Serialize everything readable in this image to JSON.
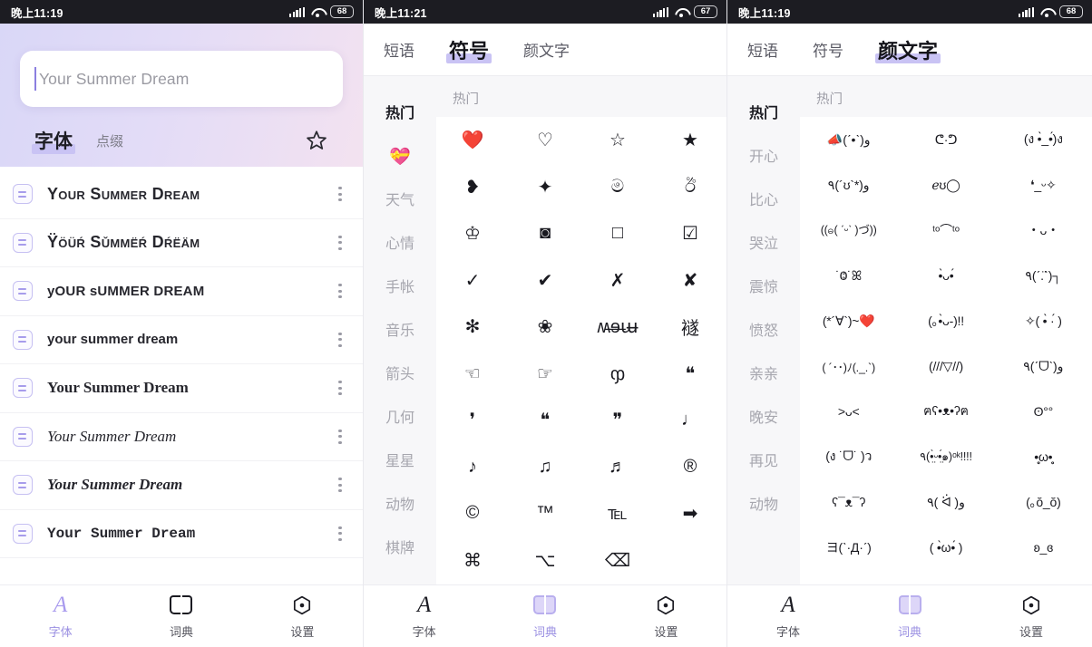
{
  "panels": [
    {
      "id": "fonts-screen",
      "status": {
        "time": "晚上11:19",
        "battery": "68"
      },
      "search": {
        "value": "",
        "placeholder": "Your Summer Dream"
      },
      "hero_tabs": [
        {
          "label": "字体",
          "active": true
        },
        {
          "label": "点缀",
          "active": false
        }
      ],
      "favorite_icon": "star-icon",
      "font_rows": [
        {
          "text": "Your Summer Dream",
          "style": "f0"
        },
        {
          "text": "Ÿöüŕ Sǔmmëŕ Dŕëäm",
          "style": "f1"
        },
        {
          "text": "yOUR sUMMER DREAM",
          "style": "f2"
        },
        {
          "text": "your summer dream",
          "style": "f3"
        },
        {
          "text": "Your Summer Dream",
          "style": "f4"
        },
        {
          "text": "Your Summer Dream",
          "style": "f5"
        },
        {
          "text": "Your Summer Dream",
          "style": "f6"
        },
        {
          "text": "Your Summer Dream",
          "style": "f7"
        }
      ],
      "bottom_nav": [
        {
          "label": "字体",
          "icon": "letter-a-icon",
          "active": true
        },
        {
          "label": "词典",
          "icon": "book-icon",
          "active": false
        },
        {
          "label": "设置",
          "icon": "gear-hex-icon",
          "active": false
        }
      ]
    },
    {
      "id": "symbols-screen",
      "status": {
        "time": "晚上11:21",
        "battery": "67"
      },
      "top_tabs": [
        {
          "label": "短语",
          "active": false
        },
        {
          "label": "符号",
          "active": true
        },
        {
          "label": "颜文字",
          "active": false
        }
      ],
      "categories": [
        {
          "label": "热门",
          "active": true
        },
        {
          "label": "💝",
          "active": false,
          "emoji": true
        },
        {
          "label": "天气",
          "active": false
        },
        {
          "label": "心情",
          "active": false
        },
        {
          "label": "手帐",
          "active": false
        },
        {
          "label": "音乐",
          "active": false
        },
        {
          "label": "箭头",
          "active": false
        },
        {
          "label": "几何",
          "active": false
        },
        {
          "label": "星星",
          "active": false
        },
        {
          "label": "动物",
          "active": false
        },
        {
          "label": "棋牌",
          "active": false
        }
      ],
      "grid_header": "热门",
      "grid_items": [
        "❤️",
        "♡",
        "☆",
        "★",
        "❥",
        "✦",
        "ම",
        "ඊ",
        "♔",
        "◙",
        "□",
        "☑",
        "✓",
        "✔",
        "✗",
        "✘",
        "✻",
        "❀",
        "ʍ̶ɘ̶ա̶",
        "襚",
        "☜",
        "☞",
        "ჶ",
        "❝",
        "❜",
        "❝",
        "❞",
        "♩",
        "♪",
        "♫",
        "♬",
        "®",
        "©",
        "™",
        "℡",
        "➡",
        "⌘",
        "⌥",
        "⌫"
      ],
      "bottom_nav": [
        {
          "label": "字体",
          "icon": "letter-a-icon",
          "active": false
        },
        {
          "label": "词典",
          "icon": "book-icon",
          "active": true
        },
        {
          "label": "设置",
          "icon": "gear-hex-icon",
          "active": false
        }
      ]
    },
    {
      "id": "kaomoji-screen",
      "status": {
        "time": "晚上11:19",
        "battery": "68"
      },
      "top_tabs": [
        {
          "label": "短语",
          "active": false
        },
        {
          "label": "符号",
          "active": false
        },
        {
          "label": "颜文字",
          "active": true
        }
      ],
      "categories": [
        {
          "label": "热门",
          "active": true
        },
        {
          "label": "开心",
          "active": false
        },
        {
          "label": "比心",
          "active": false
        },
        {
          "label": "哭泣",
          "active": false
        },
        {
          "label": "震惊",
          "active": false
        },
        {
          "label": "愤怒",
          "active": false
        },
        {
          "label": "亲亲",
          "active": false
        },
        {
          "label": "晚安",
          "active": false
        },
        {
          "label": "再见",
          "active": false
        },
        {
          "label": "动物",
          "active": false
        }
      ],
      "grid_header": "热门",
      "grid_items": [
        "📣(ˊ•ˋ)و",
        "ᕦ·ᕤ",
        "(ง •̀_•́)ง",
        "٩(´ʊ`*)و",
        "ℯʊ◯",
        "❛_ᵕ✧",
        "((ဓ( ˊᵕˋ )づ))",
        "ᵗᵒ⌒ᵗᵒ",
        "・ᴗ・",
        "˙Ⱉ˙ꕤ",
        "•̀ᴗ•́",
        "٩(ˊ.ˋ̈)┐",
        "(*´∀`)~❤️",
        "(｡•̀ᴗ-)!!",
        "✧( •̀ ·́ )",
        "( ´･･)ﾉ(._.`)",
        "(///▽//)",
        "٩(ˊᗜˋ)و",
        "˃ᴗ˂",
        "ฅʕ•ᴥ•ʔฅ",
        "ʘ°°",
        "(ง ˙ᗜ˙ )ว",
        "٩(•̤̀ᵕ•̤́๑)ᵒᵏ!!!!",
        "•̥̥̥ω•̥̥̥",
        "ʕ¯ᴥ¯ʔ",
        "٩( ᐛ )و",
        "(｡ŏ_ŏ)",
        "ヨ(ˋ·Д·ˊ)",
        "( •̀ω•́ )",
        "ʚ_ɞ"
      ],
      "bottom_nav": [
        {
          "label": "字体",
          "icon": "letter-a-icon",
          "active": false
        },
        {
          "label": "词典",
          "icon": "book-icon",
          "active": true
        },
        {
          "label": "设置",
          "icon": "gear-hex-icon",
          "active": false
        }
      ]
    }
  ]
}
